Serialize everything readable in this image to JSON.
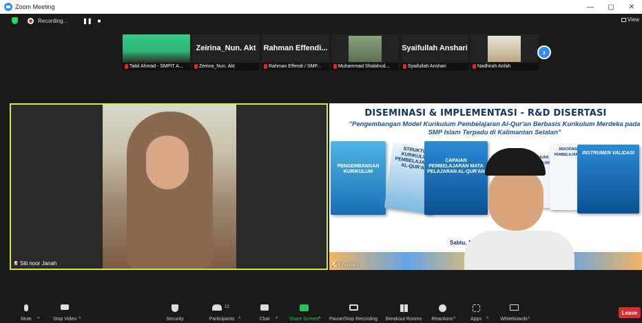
{
  "window": {
    "title": "Zoom Meeting",
    "controls": [
      "—",
      "▢",
      "✕"
    ]
  },
  "topbar": {
    "recording_label": "Recording...",
    "pause_icon": "pause-icon",
    "stop_icon": "stop-icon",
    "view_label": "View"
  },
  "thumbnails": [
    {
      "name": "Tabil Ahmad - SMPIT A...",
      "big_name": ""
    },
    {
      "name": "Zeirina_Nun. Akt",
      "big_name": "Zeirina_Nun. Akt"
    },
    {
      "name": "Rahman Effendi / SMP...",
      "big_name": "Rahman Effendi..."
    },
    {
      "name": "Muhammad Shalahud...",
      "big_name": ""
    },
    {
      "name": "Syaifullah Anshari",
      "big_name": "Syaifullah Anshari"
    },
    {
      "name": "Nadhirah Anfah",
      "big_name": ""
    }
  ],
  "main_left": {
    "name": "Siti noor Janah"
  },
  "main_right": {
    "name": "Khairani",
    "slide_title": "DISEMINASI & IMPLEMENTASI - R&D DISERTASI",
    "slide_subtitle": "\"Pengembangan Model Kurikulum Pembelajaran Al-Qur'an Berbasis Kurikulum Merdeka pada SMP Islam Terpadu di Kalimantan Selatan\"",
    "date_text": "Sabtu, 1",
    "books": [
      "PENGEMBANGAN KURIKULUM",
      "STRUKTUR KURIKULUM PEMBELAJARAN AL-QUR'AN",
      "CAPAIAN PEMBELAJARAN MATA PELAJARAN AL-QUR'AN",
      "TUJUAN PEMBELAJARAN",
      "REKOGNISI PEMBELAJARAN",
      "INSTRUMEN VALIDASI"
    ]
  },
  "toolbar": {
    "mute": "Mute",
    "stop_video": "Stop Video",
    "security": "Security",
    "participants": "Participants",
    "participant_count": "12",
    "chat": "Chat",
    "share_screen": "Share Screen",
    "record": "Pause/Stop Recording",
    "breakout": "Breakout Rooms",
    "reactions": "Reactions",
    "apps": "Apps",
    "whiteboards": "Whiteboards",
    "leave": "Leave"
  },
  "colors": {
    "accent_blue": "#2d8cff",
    "active_speaker": "#d6e84a",
    "share_green": "#23c35c",
    "leave_red": "#d62e2e"
  }
}
